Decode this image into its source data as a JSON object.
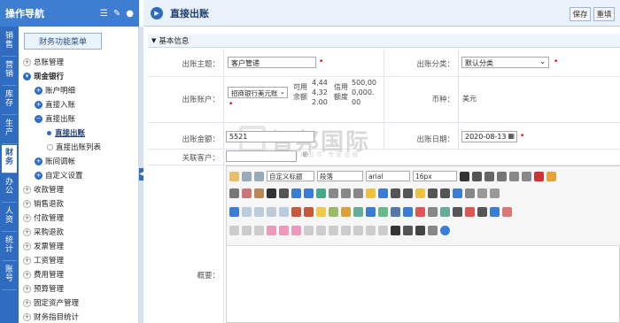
{
  "nav": {
    "title": "操作导航",
    "menu_button": "财务功能菜单",
    "vtabs": [
      "销售",
      "营销",
      "库存",
      "生产",
      "财务",
      "办公",
      "人资",
      "统计",
      "账号"
    ],
    "tree": [
      {
        "label": "总账管理",
        "marker": "+",
        "level": 0
      },
      {
        "label": "现金银行",
        "marker": "-",
        "level": 0
      },
      {
        "label": "账户明细",
        "marker": "+",
        "level": 1
      },
      {
        "label": "直接入账",
        "marker": "+",
        "level": 1
      },
      {
        "label": "直接出账",
        "marker": "-",
        "level": 1
      },
      {
        "label": "直接出账",
        "marker": "dot",
        "level": 2
      },
      {
        "label": "直接出账列表",
        "marker": "o",
        "level": 2
      },
      {
        "label": "账间调帐",
        "marker": "+",
        "level": 1
      },
      {
        "label": "自定义设置",
        "marker": "+",
        "level": 1
      },
      {
        "label": "收款管理",
        "marker": "+",
        "level": 0
      },
      {
        "label": "销售退款",
        "marker": "+",
        "level": 0
      },
      {
        "label": "付款管理",
        "marker": "+",
        "level": 0
      },
      {
        "label": "采购退款",
        "marker": "+",
        "level": 0
      },
      {
        "label": "发票管理",
        "marker": "+",
        "level": 0
      },
      {
        "label": "工资管理",
        "marker": "+",
        "level": 0
      },
      {
        "label": "费用管理",
        "marker": "+",
        "level": 0
      },
      {
        "label": "预算管理",
        "marker": "+",
        "level": 0
      },
      {
        "label": "固定资产管理",
        "marker": "+",
        "level": 0
      },
      {
        "label": "财务指目统计",
        "marker": "+",
        "level": 0
      }
    ]
  },
  "page": {
    "title": "直接出账",
    "save": "保存",
    "reset": "重填",
    "section": "基本信息"
  },
  "form": {
    "subject_label": "出账主题：",
    "subject_value": "客户管递",
    "category_label": "出账分类：",
    "category_value": "默认分类",
    "account_label": "出账账户：",
    "account_value": "招商银行美元账",
    "balance_label": "可用余额",
    "balance_value": "4,444,322.00",
    "credit_label": "信用额度",
    "credit_value": "500,000,000.00",
    "currency_label": "币种：",
    "currency_value": "美元",
    "amount_label": "出账金额：",
    "amount_value": "5521",
    "date_label": "出账日期：",
    "date_value": "2020-08-13",
    "customer_label": "关联客户：",
    "summary_label": "概要："
  },
  "editor": {
    "title_select": "自定义标题",
    "para_select": "段落",
    "font_select": "arial",
    "size_select": "16px"
  },
  "watermark": {
    "main": "智邦国际",
    "sub": "企业管理软件 专家品牌"
  }
}
